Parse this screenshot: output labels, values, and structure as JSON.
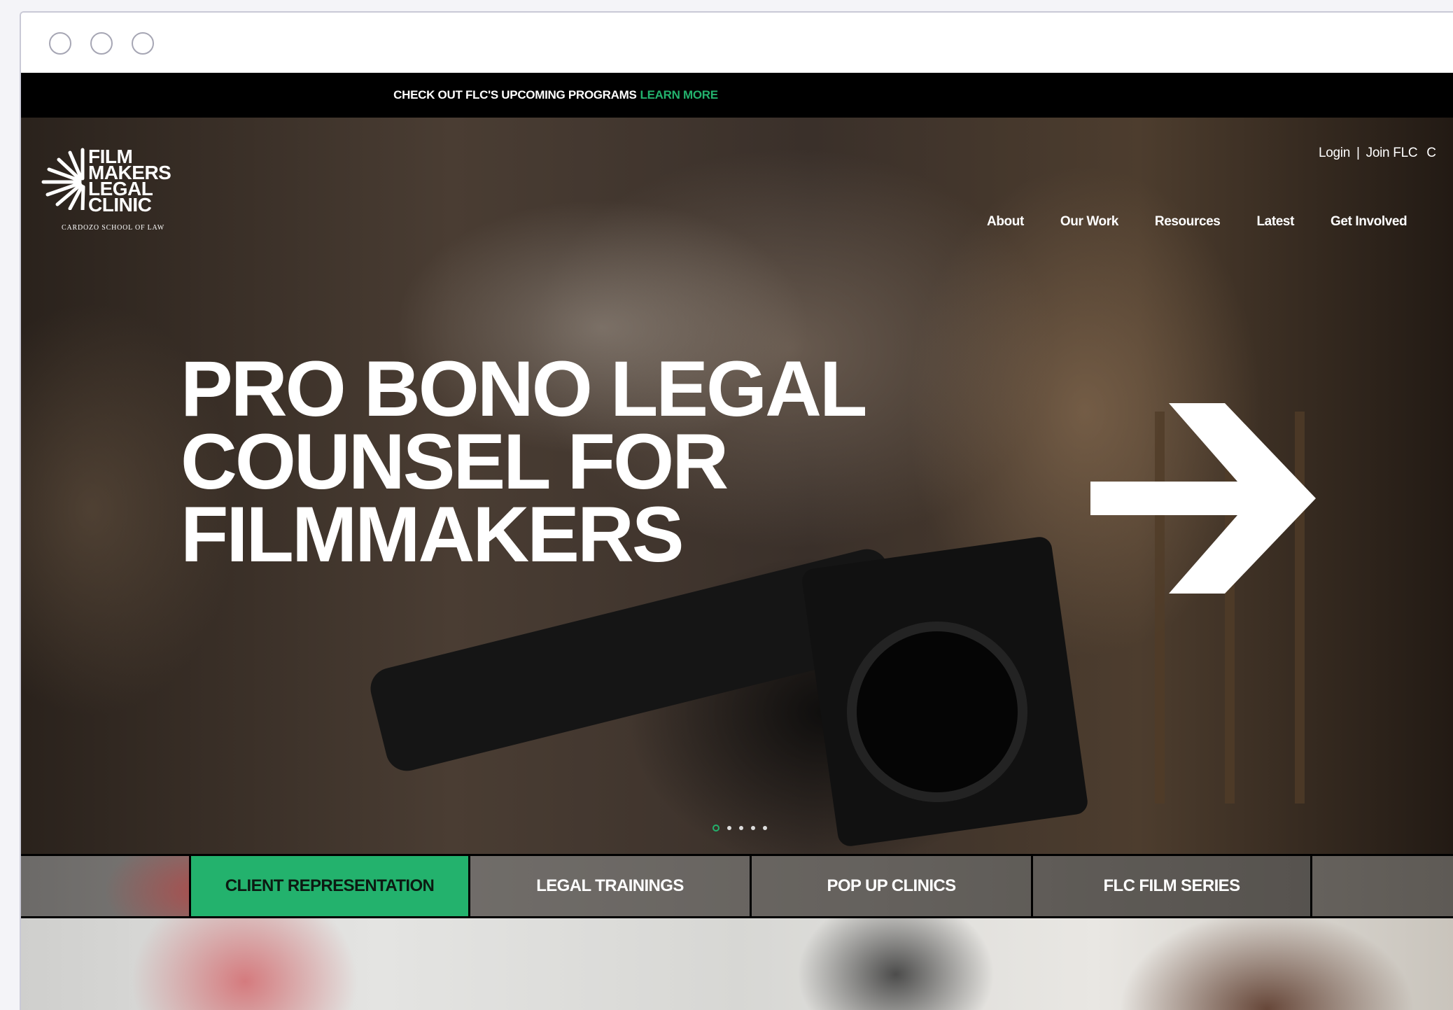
{
  "announcement": {
    "text": "CHECK OUT FLC'S UPCOMING PROGRAMS",
    "link": "LEARN MORE"
  },
  "logo": {
    "lines": "FILM\nMAKERS\nLEGAL\nCLINIC",
    "subtitle": "CARDOZO SCHOOL OF LAW"
  },
  "utility_nav": {
    "login": "Login",
    "separator": "|",
    "join": "Join FLC",
    "cut_off": "C"
  },
  "main_nav": {
    "items": [
      "About",
      "Our Work",
      "Resources",
      "Latest",
      "Get Involved"
    ]
  },
  "hero": {
    "headline": "PRO BONO LEGAL\nCOUNSEL FOR\nFILMMAKERS",
    "arrow_icon": "arrow-right-icon",
    "slides_total": 5,
    "active_slide": 1
  },
  "program_tabs": {
    "items": [
      "CLIENT REPRESENTATION",
      "LEGAL TRAININGS",
      "POP UP CLINICS",
      "FLC FILM SERIES"
    ],
    "active_index": 0
  },
  "colors": {
    "accent_green": "#23b26d",
    "announcement_bg": "#000000",
    "text_white": "#ffffff"
  }
}
